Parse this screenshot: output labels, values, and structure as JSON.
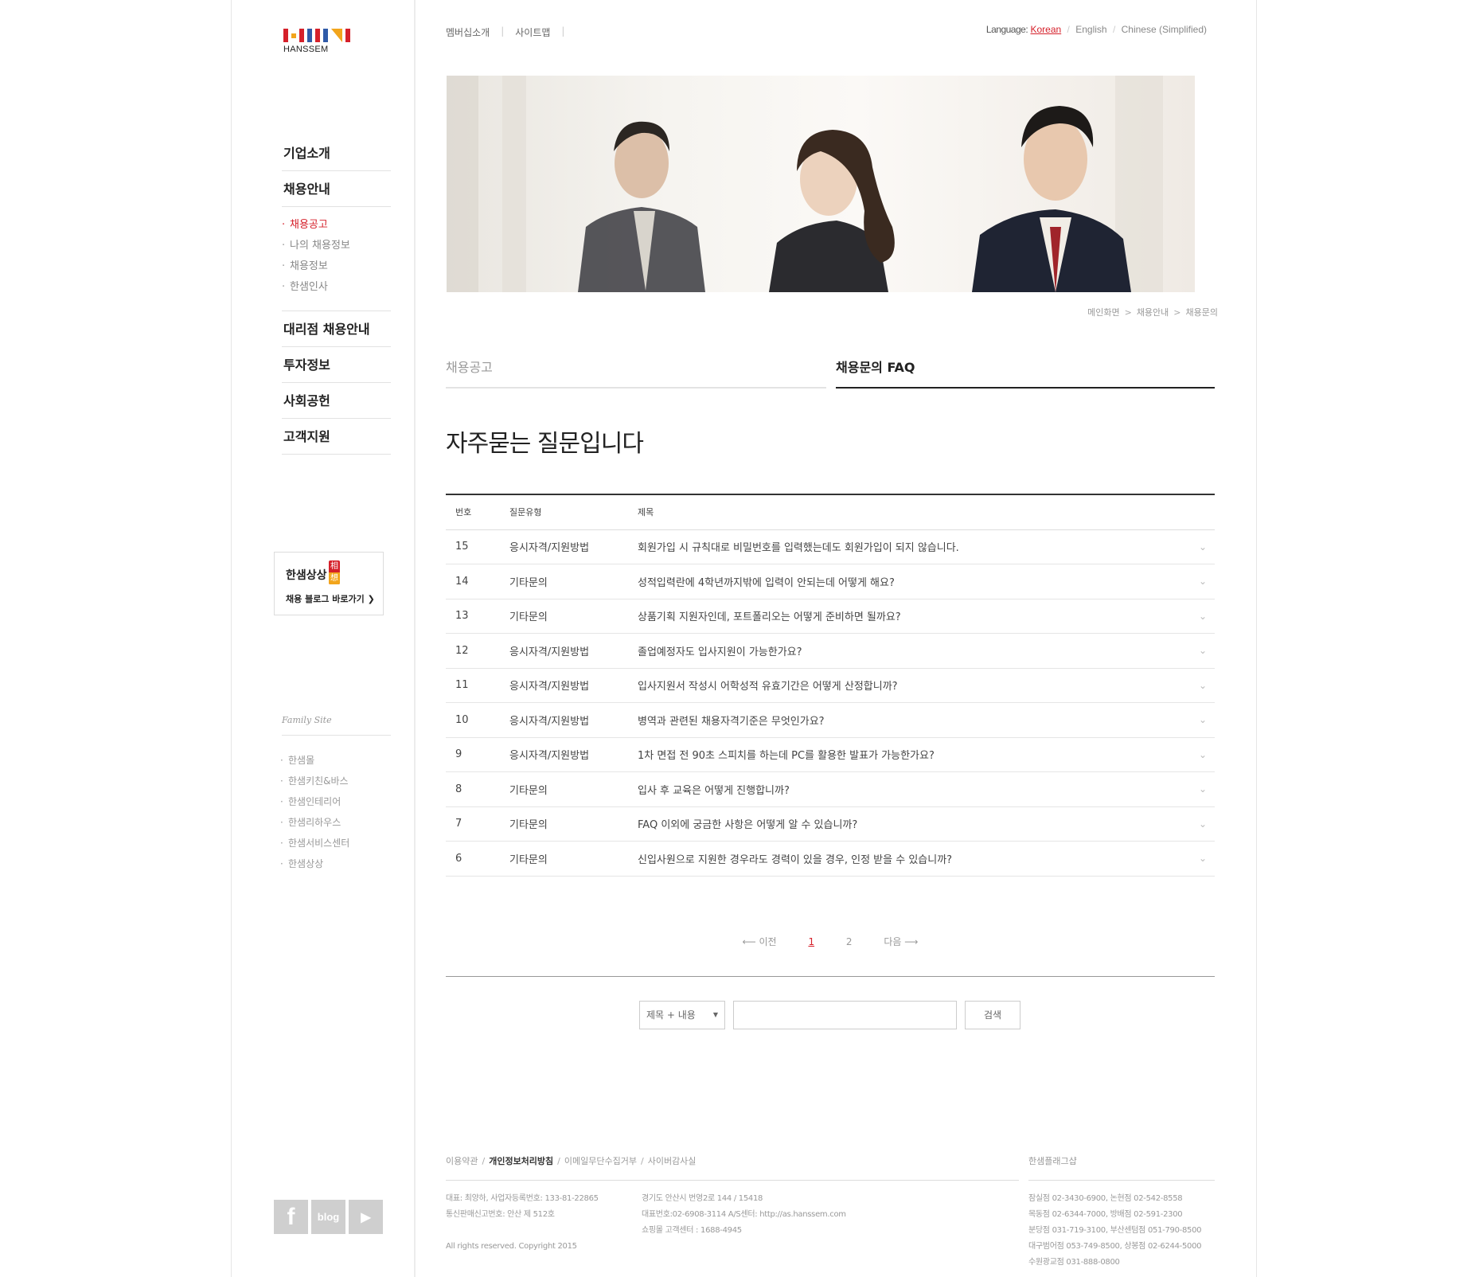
{
  "brand": {
    "name": "HANSSEM",
    "bar_colors": [
      "#d5202a",
      "#f2a51c",
      "#d5202a",
      "#2f5aa8",
      "#d5202a",
      "#2f5aa8",
      "#f2a51c"
    ]
  },
  "top_links": [
    "멤버십소개",
    "사이트맵"
  ],
  "language": {
    "label": "Language:",
    "options": [
      "Korean",
      "English",
      "Chinese (Simplified)"
    ],
    "current": "Korean"
  },
  "nav": {
    "company": "기업소개",
    "recruit": "채용안내",
    "recruit_sub": [
      "채용공고",
      "나의 채용정보",
      "채용정보",
      "한샘인사"
    ],
    "agency": "대리점 채용안내",
    "invest": "투자정보",
    "social": "사회공헌",
    "support": "고객지원"
  },
  "blog_box": {
    "title": "한샘상상",
    "seal": [
      "相",
      "想"
    ],
    "link": "채용 블로그 바로가기 ❯"
  },
  "family": {
    "title": "Family Site",
    "items": [
      "한샘몰",
      "한샘키친&바스",
      "한샘인테리어",
      "한샘리하우스",
      "한샘서비스센터",
      "한샘상상"
    ]
  },
  "social": [
    "f",
    "blog",
    "▶"
  ],
  "breadcrumb": [
    "메인화면",
    "채용안내",
    "채용문의"
  ],
  "tabs": [
    "채용공고",
    "채용문의 FAQ"
  ],
  "page_title": "자주묻는 질문입니다",
  "faq": {
    "headers": [
      "번호",
      "질문유형",
      "제목"
    ],
    "rows": [
      {
        "no": "15",
        "type": "응시자격/지원방법",
        "title": "회원가입 시 규칙대로 비밀번호를 입력했는데도 회원가입이 되지 않습니다."
      },
      {
        "no": "14",
        "type": "기타문의",
        "title": "성적입력란에 4학년까지밖에 입력이 안되는데 어떻게 해요?"
      },
      {
        "no": "13",
        "type": "기타문의",
        "title": "상품기획 지원자인데, 포트폴리오는 어떻게 준비하면 될까요?"
      },
      {
        "no": "12",
        "type": "응시자격/지원방법",
        "title": "졸업예정자도 입사지원이 가능한가요?"
      },
      {
        "no": "11",
        "type": "응시자격/지원방법",
        "title": "입사지원서 작성시 어학성적 유효기간은 어떻게 산정합니까?"
      },
      {
        "no": "10",
        "type": "응시자격/지원방법",
        "title": "병역과 관련된 채용자격기준은 무엇인가요?"
      },
      {
        "no": "9",
        "type": "응시자격/지원방법",
        "title": "1차 면접 전 90초 스피치를 하는데 PC를 활용한 발표가 가능한가요?"
      },
      {
        "no": "8",
        "type": "기타문의",
        "title": "입사 후 교육은 어떻게 진행합니까?"
      },
      {
        "no": "7",
        "type": "기타문의",
        "title": "FAQ 이외에 궁금한 사항은 어떻게 알 수 있습니까?"
      },
      {
        "no": "6",
        "type": "기타문의",
        "title": "신입사원으로 지원한 경우라도 경력이 있을 경우, 인정 받을 수 있습니까?"
      }
    ]
  },
  "pager": {
    "prev": "⟵ 이전",
    "pages": [
      "1",
      "2"
    ],
    "current": "1",
    "next": "다음 ⟶"
  },
  "search": {
    "select": "제목 + 내용",
    "value": "",
    "button": "검색"
  },
  "footer": {
    "links": [
      "이용약관",
      "개인정보처리방침",
      "이메일무단수집거부",
      "사이버감사실"
    ],
    "col1": [
      "대표: 최양하, 사업자등록번호: 133-81-22865",
      "통신판매신고번호: 안산 제 512호",
      "",
      "All rights reserved. Copyright 2015"
    ],
    "col2": [
      "경기도 안산시 번영2로 144 / 15418",
      "대표번호:02-6908-3114    A/S센터: http://as.hanssem.com",
      "쇼핑몰 고객센터 : 1688-4945"
    ],
    "flagship_title": "한샘플래그샵",
    "flagship": [
      "잠실점 02-3430-6900, 논현점 02-542-8558",
      "목동점 02-6344-7000, 방배점 02-591-2300",
      "분당점 031-719-3100, 부산센텀점 051-790-8500",
      "대구범어점 053-749-8500, 상봉점 02-6244-5000",
      "수원광교점 031-888-0800"
    ]
  }
}
